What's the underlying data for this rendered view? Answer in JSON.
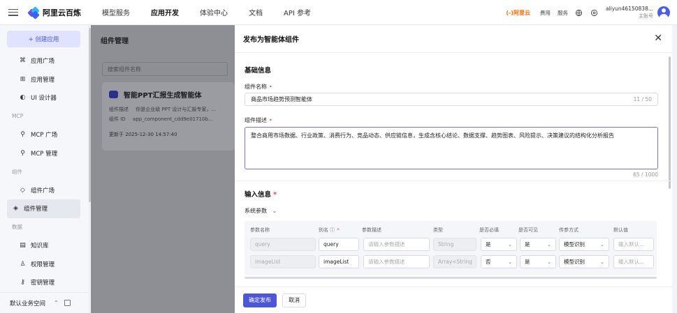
{
  "topbar": {
    "brand": "阿里云百炼",
    "nav": [
      "模型服务",
      "应用开发",
      "体验中心",
      "文档",
      "API 参考"
    ],
    "nav_active_index": 1,
    "aliyun_brand": "(-)阿里云",
    "links": [
      "费用",
      "服务"
    ],
    "user_name": "aliyun46150838...",
    "user_account": "主账号"
  },
  "sidebar": {
    "create_label": "+ 创建应用",
    "items": [
      {
        "type": "item",
        "label": "应用广场",
        "icon": "apps-grid-icon"
      },
      {
        "type": "item",
        "label": "应用管理",
        "icon": "app-manage-icon"
      },
      {
        "type": "item",
        "label": "UI 设计器",
        "icon": "palette-icon"
      },
      {
        "type": "group",
        "label": "MCP"
      },
      {
        "type": "item",
        "label": "MCP 广场",
        "icon": "mcp-icon"
      },
      {
        "type": "item",
        "label": "MCP 管理",
        "icon": "mcp-manage-icon"
      },
      {
        "type": "group",
        "label": "组件"
      },
      {
        "type": "item",
        "label": "组件广场",
        "icon": "component-icon"
      },
      {
        "type": "item",
        "label": "组件管理",
        "icon": "component-manage-icon",
        "active": true
      },
      {
        "type": "group",
        "label": "数据"
      },
      {
        "type": "item",
        "label": "知识库",
        "icon": "book-icon"
      },
      {
        "type": "item",
        "label": "权限管理",
        "icon": "user-icon"
      },
      {
        "type": "item",
        "label": "密钥管理",
        "icon": "key-icon"
      }
    ],
    "workspace": "默认业务空间"
  },
  "main": {
    "title": "组件管理",
    "search_placeholder": "搜索组件名称",
    "card": {
      "title": "智能PPT汇报生成智能体",
      "desc_label": "组件描述",
      "desc_value": "你是企业级 PPT 设计与汇报专家，...",
      "id_label": "组件 ID",
      "id_value": "app_component_cdd9e01710b...",
      "updated": "更新于 2025-12-30 14:57:40"
    }
  },
  "drawer": {
    "title": "发布为智能体组件",
    "basic_info": "基础信息",
    "name_label": "组件名称",
    "name_value": "商品市场趋势预测智能体",
    "name_count": "11 / 50",
    "desc_label": "组件描述",
    "desc_value": "整合商用市场数据、行业政策、消费行为、竞品动态、供应链信息，生成含核心结论、数据支撑、趋势图表、风险提示、决策建议的结构化分析报告",
    "desc_count": "65 / 1000",
    "input_info": "输入信息",
    "system_params": "系统参数",
    "table_headers": [
      "参数名称",
      "别名 ⓘ",
      "参数描述",
      "类型",
      "是否必填",
      "是否可见",
      "传参方式",
      "默认值"
    ],
    "rows": [
      {
        "name": "query",
        "alias": "query",
        "desc_ph": "请输入参数描述",
        "type": "String",
        "required": "是",
        "visible": "是",
        "mode": "模型识别",
        "default_ph": "输入默认..."
      },
      {
        "name": "imageList",
        "alias": "imageList",
        "desc_ph": "请输入参数描述",
        "type": "Array<String",
        "required": "否",
        "visible": "是",
        "mode": "模型识别",
        "default_ph": "输入默认..."
      }
    ],
    "confirm": "确定发布",
    "cancel": "取消"
  },
  "colors": {
    "primary": "#4d55d8",
    "required": "#e5484d",
    "brand_orange": "#ff6a00"
  }
}
